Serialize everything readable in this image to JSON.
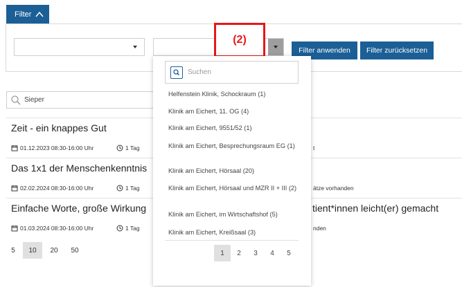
{
  "filter": {
    "tab_label": "Filter",
    "apply_label": "Filter anwenden",
    "reset_label": "Filter zurücksetzen"
  },
  "annotation": {
    "label": "(2)",
    "color": "#e61717"
  },
  "search": {
    "value": "Sieper"
  },
  "events": [
    {
      "title": "Zeit - ein knappes Gut",
      "date": "01.12.2023 08:30-16:00 Uhr",
      "duration": "1 Tag",
      "tail": "t",
      "tail_title": ""
    },
    {
      "title": "Das 1x1 der Menschenkenntnis",
      "date": "02.02.2024 08:30-16:00 Uhr",
      "duration": "1 Tag",
      "tail": "ätze vorhanden",
      "tail_title": ""
    },
    {
      "title": "Einfache Worte, große Wirkung",
      "date": "01.03.2024 08:30-16:00 Uhr",
      "duration": "1 Tag",
      "tail": "nden",
      "tail_title": "tient*innen leicht(er) gemacht"
    }
  ],
  "page_sizes": [
    "5",
    "10",
    "20",
    "50"
  ],
  "page_size_selected": "10",
  "dropdown": {
    "search_placeholder": "Suchen",
    "items": [
      "Helfenstein Klinik, Schockraum (1)",
      "Klinik am Eichert, 11. OG (4)",
      "Klinik am Eichert, 9551/52 (1)",
      "Klinik am Eichert, Besprechungsraum EG (1)",
      "Klinik am Eichert, Hörsaal (20)",
      "Klinik am Eichert, Hörsaal und MZR II + III (2)",
      "Klinik am Eichert, im Wirtschaftshof (5)",
      "Klinik am Eichert, Kreißsaal (3)"
    ],
    "pages": [
      "1",
      "2",
      "3",
      "4",
      "5"
    ],
    "current_page": "1"
  },
  "colors": {
    "primary": "#1b5f96",
    "active_gray": "#e0e0e0"
  },
  "icons": {
    "filter_tab": "chevron-up-icon",
    "select": "caret-down-icon",
    "search": "magnifier-icon",
    "date": "calendar-icon",
    "duration": "clock-icon"
  }
}
